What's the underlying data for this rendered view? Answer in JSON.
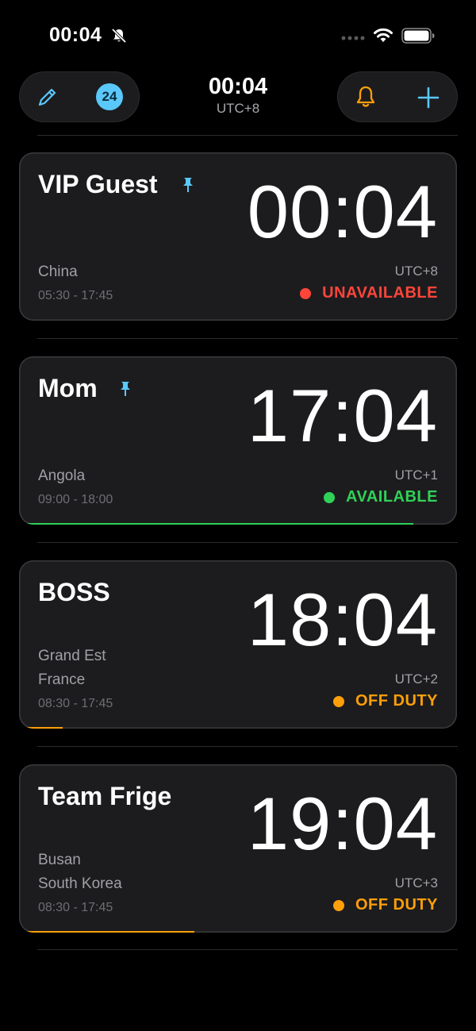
{
  "status_bar": {
    "time": "00:04"
  },
  "header": {
    "badge": "24",
    "time": "00:04",
    "timezone": "UTC+8"
  },
  "colors": {
    "accent": "#5ac8fa",
    "bell": "#ff9f0a",
    "unavailable": "#ff453a",
    "available": "#30d158",
    "off_duty": "#ff9f0a"
  },
  "contacts": [
    {
      "name": "VIP Guest",
      "pinned": true,
      "time": "00:04",
      "location_line1": "China",
      "location_line2": "",
      "hours": "05:30 - 17:45",
      "timezone": "UTC+8",
      "status": "UNAVAILABLE",
      "status_color": "#ff453a",
      "day_progress": 0
    },
    {
      "name": "Mom",
      "pinned": true,
      "time": "17:04",
      "location_line1": "Angola",
      "location_line2": "",
      "hours": "09:00 - 18:00",
      "timezone": "UTC+1",
      "status": "AVAILABLE",
      "status_color": "#30d158",
      "day_progress": 0.9
    },
    {
      "name": "BOSS",
      "pinned": false,
      "time": "18:04",
      "location_line1": "Grand Est",
      "location_line2": "France",
      "hours": "08:30 - 17:45",
      "timezone": "UTC+2",
      "status": "OFF DUTY",
      "status_color": "#ff9f0a",
      "day_progress": 0.1
    },
    {
      "name": "Team Frige",
      "pinned": false,
      "time": "19:04",
      "location_line1": "Busan",
      "location_line2": "South Korea",
      "hours": "08:30 - 17:45",
      "timezone": "UTC+3",
      "status": "OFF DUTY",
      "status_color": "#ff9f0a",
      "day_progress": 0.4
    }
  ]
}
